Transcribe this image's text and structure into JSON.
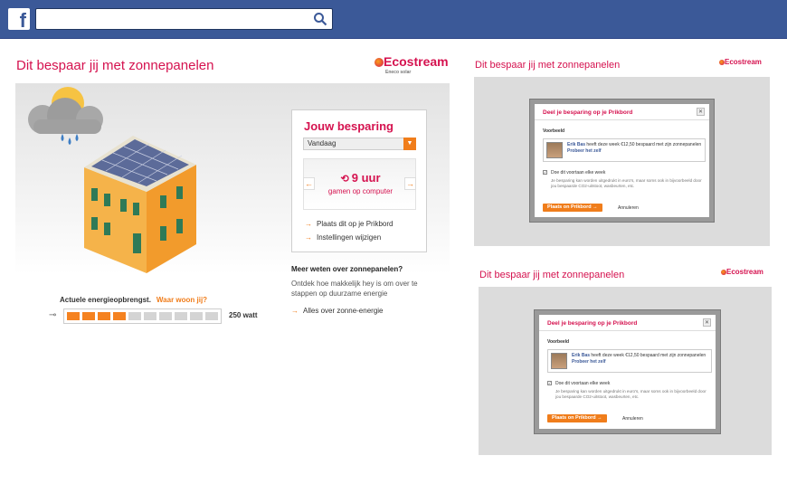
{
  "facebook": {
    "logo": "f",
    "search_placeholder": ""
  },
  "main": {
    "title": "Dit bespaar jij met zonnepanelen",
    "brand": "Ecostream",
    "brand_sub": "Eneco solar",
    "panel": {
      "title": "Jouw besparing",
      "period_select": "Vandaag",
      "saving_value": "9 uur",
      "saving_text": "gamen op computer",
      "link_prikbord": "Plaats dit op je Prikbord",
      "link_settings": "Instellingen wijzigen"
    },
    "more": {
      "heading": "Meer weten over zonnepanelen?",
      "text": "Ontdek hoe makkelijk hey is om over te stappen op duurzame energie",
      "link": "Alles over zonne-energie"
    },
    "energy": {
      "label": "Actuele energieopbrengst.",
      "where": "Waar woon jij?",
      "level_segments_on": 4,
      "segments_total": 10,
      "watt": "250 watt"
    }
  },
  "dialog": {
    "title": "Deel je besparing op je Prikbord",
    "preview_label": "Voorbeeld",
    "post_name": "Erik Bas",
    "post_text": "heeft deze week €12,50 bespaard met zijn zonnepanelen",
    "post_link": "Probeer het zelf",
    "checkbox_label": "Doe dit voortaan elke week",
    "note": "Je besparing kan worden uitgedrukt in euro's, maar soms ook in bijvoorbeeld door jou bespaarde CO2-uitstoot, wasbeurten, etc.",
    "submit": "Plaats on Prikbord",
    "cancel": "Annuleren"
  },
  "colors": {
    "brand": "#d5124f",
    "accent": "#f07d1b",
    "facebook": "#3b5998"
  }
}
